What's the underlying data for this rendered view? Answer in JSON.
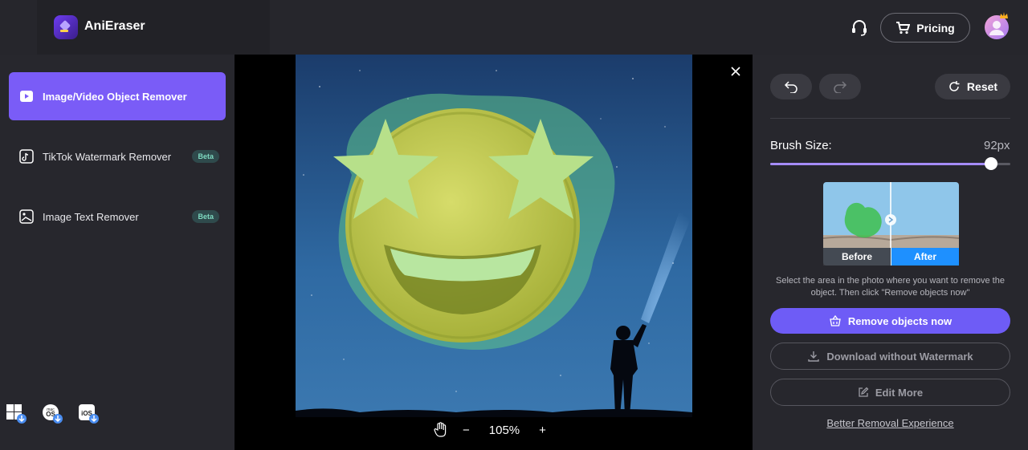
{
  "app": {
    "name": "AniEraser"
  },
  "header": {
    "pricing_label": "Pricing"
  },
  "sidebar": {
    "items": [
      {
        "label": "Image/Video Object Remover",
        "active": true
      },
      {
        "label": "TikTok Watermark Remover",
        "badge": "Beta"
      },
      {
        "label": "Image Text Remover",
        "badge": "Beta"
      }
    ],
    "platforms": [
      "windows-download-icon",
      "macos-download-icon",
      "ios-download-icon"
    ]
  },
  "canvas": {
    "zoom": "105%",
    "zoom_out": "−",
    "zoom_in": "+"
  },
  "panel": {
    "reset_label": "Reset",
    "brush_label": "Brush Size:",
    "brush_value": "92px",
    "brush_level": 0.92,
    "preview_before": "Before",
    "preview_after": "After",
    "hint": "Select the area in the photo where you want to remove the object. Then click \"Remove objects now\"",
    "remove_label": "Remove objects now",
    "download_label": "Download without Watermark",
    "edit_label": "Edit More",
    "better_link": "Better Removal Experience"
  },
  "colors": {
    "accent": "#7a5cf7",
    "primary_button": "#6e5cf6",
    "preview_after": "#1e90ff"
  }
}
